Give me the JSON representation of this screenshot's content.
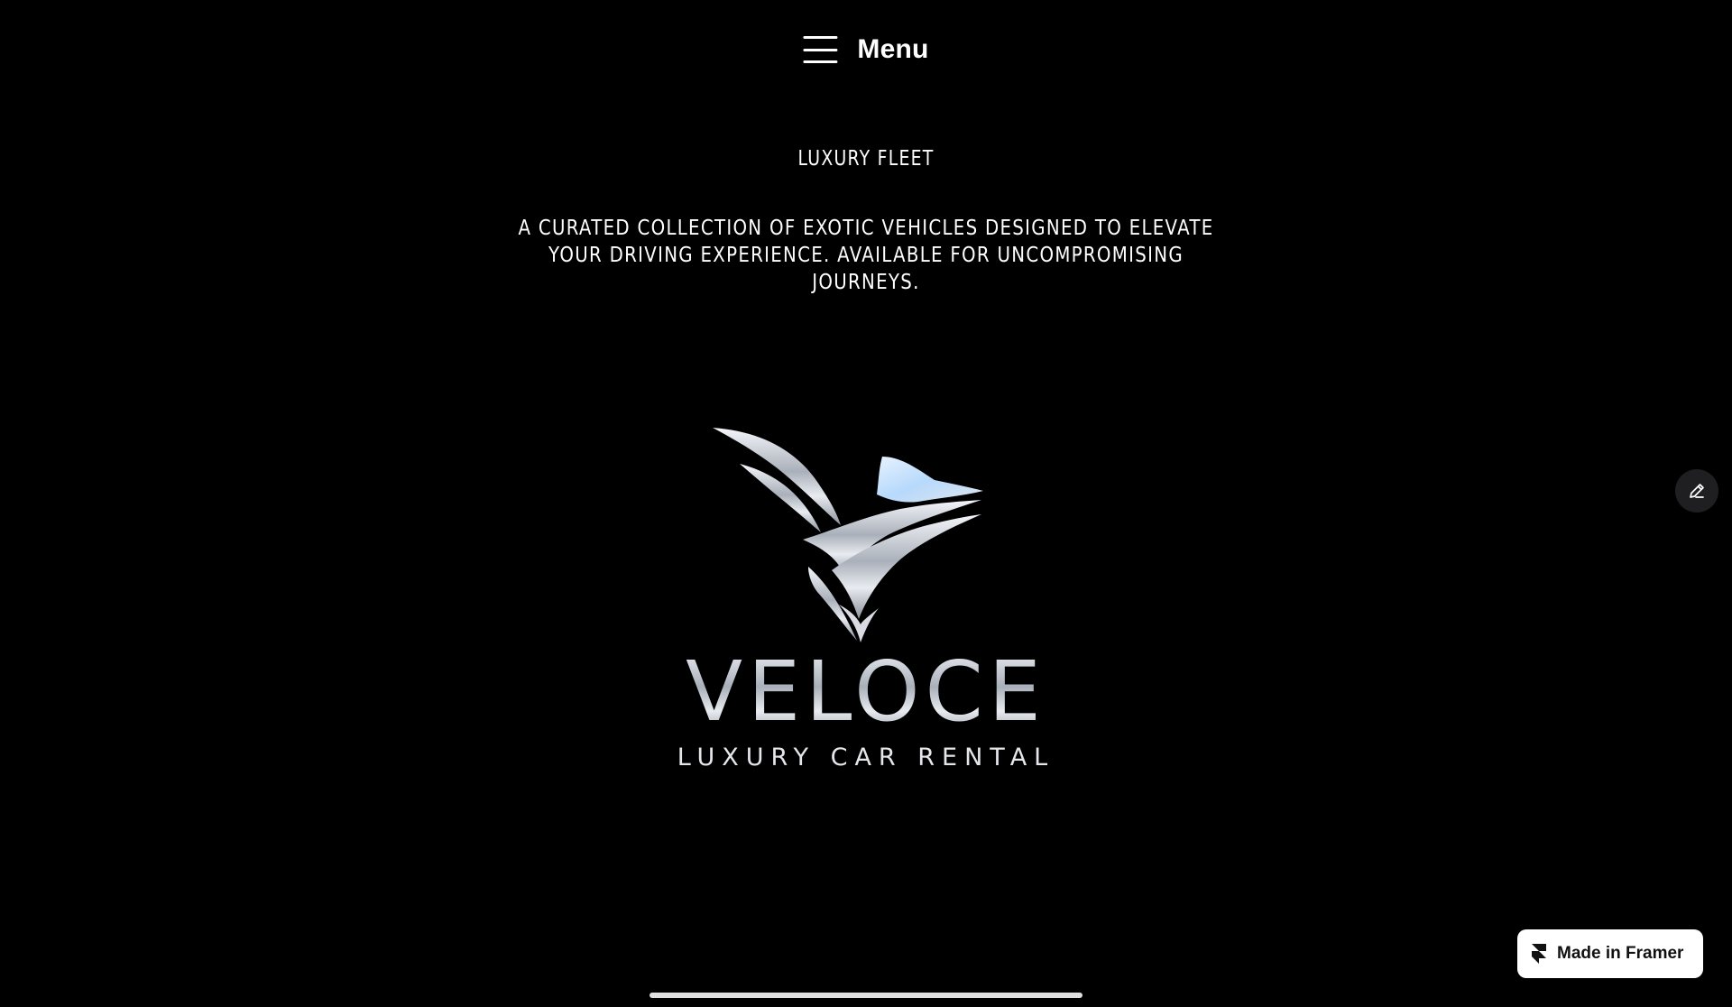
{
  "header": {
    "menu_icon": "hamburger-icon",
    "menu_label": "Menu"
  },
  "section": {
    "kicker": "LUXURY FLEET",
    "lede": "A CURATED COLLECTION OF EXOTIC VEHICLES DESIGNED TO ELEVATE YOUR DRIVING EXPERIENCE. AVAILABLE FOR UNCOMPROMISING JOURNEYS."
  },
  "logo": {
    "wordmark": "VELOCE",
    "tagline": "LUXURY CAR RENTAL",
    "emblem_icon": "bird-wing-emblem-icon"
  },
  "edit_button": {
    "icon": "pencil-icon"
  },
  "badge": {
    "icon": "framer-logo-icon",
    "label": "Made in Framer"
  },
  "colors": {
    "background": "#000000",
    "text": "#ffffff",
    "logo_silver": "#c9ccd3",
    "logo_highlight": "#bfe0ff",
    "badge_background": "#ffffff",
    "edit_button_background": "#1f1f21"
  }
}
